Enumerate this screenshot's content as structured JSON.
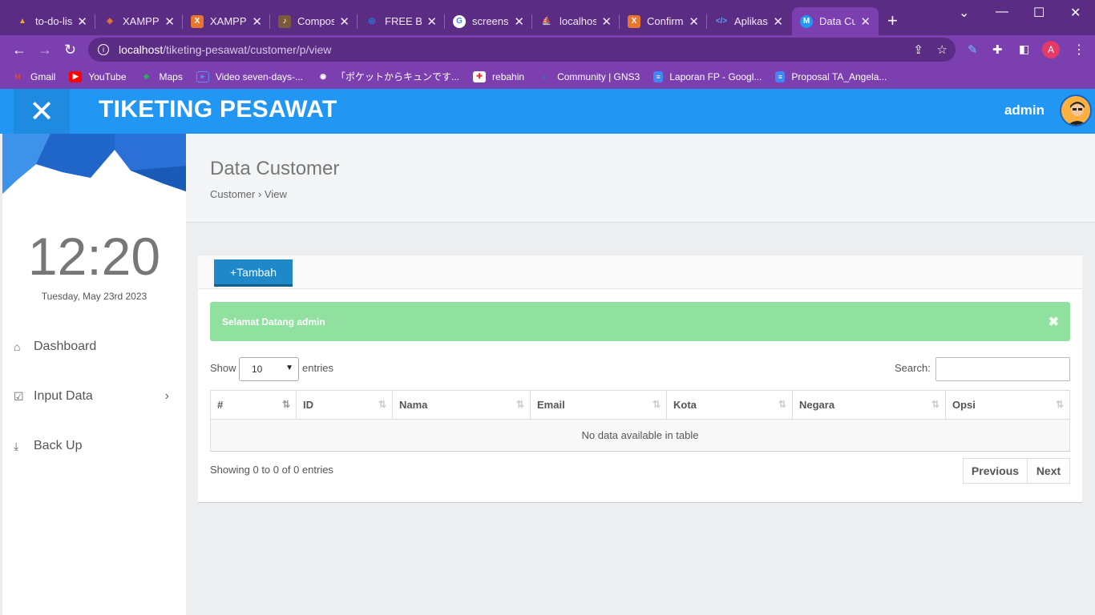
{
  "browser": {
    "tabs": [
      {
        "title": "to-do-lis",
        "icon": "firebase-icon",
        "color": "#f5a623"
      },
      {
        "title": "XAMPP",
        "icon": "xampp-icon",
        "color": "#e8772e"
      },
      {
        "title": "XAMPP",
        "icon": "xampp-icon",
        "color": "#e8772e"
      },
      {
        "title": "Compos",
        "icon": "composer-icon",
        "color": "#7b5a3a"
      },
      {
        "title": "FREE Bu",
        "icon": "globe-icon",
        "color": "#1e88e5"
      },
      {
        "title": "screensh",
        "icon": "google-icon",
        "color": "#ffffff"
      },
      {
        "title": "localhos",
        "icon": "phpmyadmin-icon",
        "color": "#f89c0e"
      },
      {
        "title": "Confirm",
        "icon": "xampp-icon",
        "color": "#e8772e"
      },
      {
        "title": "Aplikasi",
        "icon": "code-icon",
        "color": "#4fa3ff"
      },
      {
        "title": "Data Cu",
        "icon": "m-icon",
        "color": "#2196f3"
      }
    ],
    "url_host": "localhost",
    "url_path": "/tiketing-pesawat/customer/p/view",
    "profile_initial": "A",
    "bookmarks": [
      {
        "label": "Gmail",
        "icon": "gmail-icon",
        "color": "#ea4335"
      },
      {
        "label": "YouTube",
        "icon": "youtube-icon",
        "color": "#ff0000"
      },
      {
        "label": "Maps",
        "icon": "maps-icon",
        "color": "#34a853"
      },
      {
        "label": "Video seven-days-...",
        "icon": "video-icon",
        "color": "#5c8df6"
      },
      {
        "label": "「ポケットからキュンです...",
        "icon": "globe-icon",
        "color": "#ffffff"
      },
      {
        "label": "rebahin",
        "icon": "rebahin-icon",
        "color": "#e53935"
      },
      {
        "label": "Community | GNS3",
        "icon": "gns3-icon",
        "color": "#2a7ae2"
      },
      {
        "label": "Laporan FP - Googl...",
        "icon": "docs-icon",
        "color": "#4285f4"
      },
      {
        "label": "Proposal TA_Angela...",
        "icon": "docs-icon",
        "color": "#4285f4"
      }
    ]
  },
  "app": {
    "title": "TIKETING PESAWAT",
    "user": "admin",
    "accent": "#2196f3"
  },
  "sidebar": {
    "time": "12:20",
    "date": "Tuesday, May 23rd 2023",
    "menu": [
      {
        "label": "Dashboard",
        "icon": "home-icon"
      },
      {
        "label": "Input Data",
        "icon": "check-square-icon"
      },
      {
        "label": "Back Up",
        "icon": "download-icon"
      }
    ]
  },
  "page": {
    "title": "Data Customer",
    "breadcrumb": "Customer › View",
    "add_button": "+Tambah",
    "alert": "Selamat Datang admin",
    "show_label": "Show",
    "entries_value": "10",
    "entries_label": "entries",
    "search_label": "Search:",
    "columns": [
      "#",
      "ID",
      "Nama",
      "Email",
      "Kota",
      "Negara",
      "Opsi"
    ],
    "empty_text": "No data available in table",
    "info": "Showing 0 to 0 of 0 entries",
    "prev": "Previous",
    "next": "Next"
  }
}
